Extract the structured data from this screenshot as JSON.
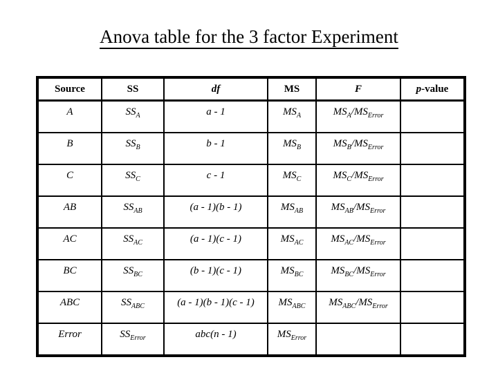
{
  "slide": {
    "title": "Anova table for the 3 factor Experiment",
    "background_color": "#ffffff",
    "text_color": "#000000"
  },
  "table": {
    "name": "anova-table",
    "border_color": "#000000",
    "headers": [
      {
        "key": "source",
        "label": "Source",
        "style": "bold"
      },
      {
        "key": "ss",
        "label": "SS",
        "style": "bold"
      },
      {
        "key": "df",
        "label": "df",
        "style": "bold-italic"
      },
      {
        "key": "ms",
        "label": "MS",
        "style": "bold"
      },
      {
        "key": "f",
        "label": "F",
        "style": "bold-italic"
      },
      {
        "key": "p",
        "label_italic": "p",
        "label_rest": "-value",
        "style": "bold-italic-mixed"
      }
    ],
    "rows": [
      {
        "source": "A",
        "ss_base": "SS",
        "ss_sub": "A",
        "df": "a - 1",
        "ms_base": "MS",
        "ms_sub": "A",
        "f_num_base": "MS",
        "f_num_sub": "A",
        "f_den_base": "MS",
        "f_den_sub": "Error",
        "p": ""
      },
      {
        "source": "B",
        "ss_base": "SS",
        "ss_sub": "B",
        "df": "b - 1",
        "ms_base": "MS",
        "ms_sub": "B",
        "f_num_base": "MS",
        "f_num_sub": "B",
        "f_den_base": "MS",
        "f_den_sub": "Error",
        "p": ""
      },
      {
        "source": "C",
        "ss_base": "SS",
        "ss_sub": "C",
        "df": "c - 1",
        "ms_base": "MS",
        "ms_sub": "C",
        "f_num_base": "MS",
        "f_num_sub": "C",
        "f_den_base": "MS",
        "f_den_sub": "Error",
        "p": ""
      },
      {
        "source": "AB",
        "ss_base": "SS",
        "ss_sub": "AB",
        "df": "(a - 1)(b - 1)",
        "ms_base": "MS",
        "ms_sub": "AB",
        "f_num_base": "MS",
        "f_num_sub": "AB",
        "f_den_base": "MS",
        "f_den_sub": "Error",
        "p": ""
      },
      {
        "source": "AC",
        "ss_base": "SS",
        "ss_sub": "AC",
        "df": "(a - 1)(c - 1)",
        "ms_base": "MS",
        "ms_sub": "AC",
        "f_num_base": "MS",
        "f_num_sub": "AC",
        "f_den_base": "MS",
        "f_den_sub": "Error",
        "p": ""
      },
      {
        "source": "BC",
        "ss_base": "SS",
        "ss_sub": "BC",
        "df": "(b - 1)(c - 1)",
        "ms_base": "MS",
        "ms_sub": "BC",
        "f_num_base": "MS",
        "f_num_sub": "BC",
        "f_den_base": "MS",
        "f_den_sub": "Error",
        "p": ""
      },
      {
        "source": "ABC",
        "ss_base": "SS",
        "ss_sub": "ABC",
        "df": "(a - 1)(b - 1)(c - 1)",
        "ms_base": "MS",
        "ms_sub": "ABC",
        "f_num_base": "MS",
        "f_num_sub": "ABC",
        "f_den_base": "MS",
        "f_den_sub": "Error",
        "p": ""
      },
      {
        "source": "Error",
        "ss_base": "SS",
        "ss_sub": "Error",
        "df": "abc(n - 1)",
        "ms_base": "MS",
        "ms_sub": "Error",
        "f_num_base": "",
        "f_num_sub": "",
        "f_den_base": "",
        "f_den_sub": "",
        "p": ""
      }
    ],
    "divider": "/"
  }
}
